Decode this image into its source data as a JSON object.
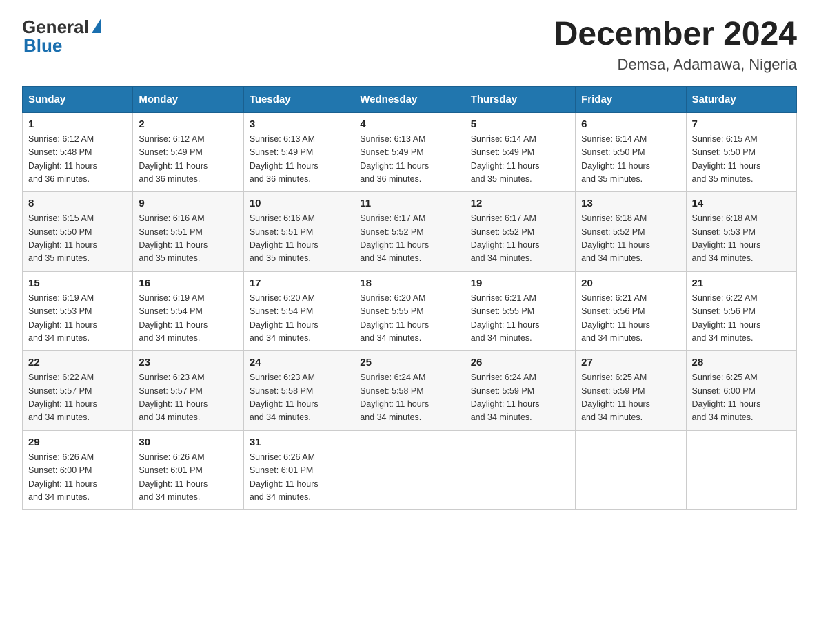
{
  "logo": {
    "general": "General",
    "blue": "Blue"
  },
  "title": "December 2024",
  "subtitle": "Demsa, Adamawa, Nigeria",
  "headers": [
    "Sunday",
    "Monday",
    "Tuesday",
    "Wednesday",
    "Thursday",
    "Friday",
    "Saturday"
  ],
  "weeks": [
    [
      {
        "day": "1",
        "sunrise": "6:12 AM",
        "sunset": "5:48 PM",
        "daylight": "11 hours and 36 minutes."
      },
      {
        "day": "2",
        "sunrise": "6:12 AM",
        "sunset": "5:49 PM",
        "daylight": "11 hours and 36 minutes."
      },
      {
        "day": "3",
        "sunrise": "6:13 AM",
        "sunset": "5:49 PM",
        "daylight": "11 hours and 36 minutes."
      },
      {
        "day": "4",
        "sunrise": "6:13 AM",
        "sunset": "5:49 PM",
        "daylight": "11 hours and 36 minutes."
      },
      {
        "day": "5",
        "sunrise": "6:14 AM",
        "sunset": "5:49 PM",
        "daylight": "11 hours and 35 minutes."
      },
      {
        "day": "6",
        "sunrise": "6:14 AM",
        "sunset": "5:50 PM",
        "daylight": "11 hours and 35 minutes."
      },
      {
        "day": "7",
        "sunrise": "6:15 AM",
        "sunset": "5:50 PM",
        "daylight": "11 hours and 35 minutes."
      }
    ],
    [
      {
        "day": "8",
        "sunrise": "6:15 AM",
        "sunset": "5:50 PM",
        "daylight": "11 hours and 35 minutes."
      },
      {
        "day": "9",
        "sunrise": "6:16 AM",
        "sunset": "5:51 PM",
        "daylight": "11 hours and 35 minutes."
      },
      {
        "day": "10",
        "sunrise": "6:16 AM",
        "sunset": "5:51 PM",
        "daylight": "11 hours and 35 minutes."
      },
      {
        "day": "11",
        "sunrise": "6:17 AM",
        "sunset": "5:52 PM",
        "daylight": "11 hours and 34 minutes."
      },
      {
        "day": "12",
        "sunrise": "6:17 AM",
        "sunset": "5:52 PM",
        "daylight": "11 hours and 34 minutes."
      },
      {
        "day": "13",
        "sunrise": "6:18 AM",
        "sunset": "5:52 PM",
        "daylight": "11 hours and 34 minutes."
      },
      {
        "day": "14",
        "sunrise": "6:18 AM",
        "sunset": "5:53 PM",
        "daylight": "11 hours and 34 minutes."
      }
    ],
    [
      {
        "day": "15",
        "sunrise": "6:19 AM",
        "sunset": "5:53 PM",
        "daylight": "11 hours and 34 minutes."
      },
      {
        "day": "16",
        "sunrise": "6:19 AM",
        "sunset": "5:54 PM",
        "daylight": "11 hours and 34 minutes."
      },
      {
        "day": "17",
        "sunrise": "6:20 AM",
        "sunset": "5:54 PM",
        "daylight": "11 hours and 34 minutes."
      },
      {
        "day": "18",
        "sunrise": "6:20 AM",
        "sunset": "5:55 PM",
        "daylight": "11 hours and 34 minutes."
      },
      {
        "day": "19",
        "sunrise": "6:21 AM",
        "sunset": "5:55 PM",
        "daylight": "11 hours and 34 minutes."
      },
      {
        "day": "20",
        "sunrise": "6:21 AM",
        "sunset": "5:56 PM",
        "daylight": "11 hours and 34 minutes."
      },
      {
        "day": "21",
        "sunrise": "6:22 AM",
        "sunset": "5:56 PM",
        "daylight": "11 hours and 34 minutes."
      }
    ],
    [
      {
        "day": "22",
        "sunrise": "6:22 AM",
        "sunset": "5:57 PM",
        "daylight": "11 hours and 34 minutes."
      },
      {
        "day": "23",
        "sunrise": "6:23 AM",
        "sunset": "5:57 PM",
        "daylight": "11 hours and 34 minutes."
      },
      {
        "day": "24",
        "sunrise": "6:23 AM",
        "sunset": "5:58 PM",
        "daylight": "11 hours and 34 minutes."
      },
      {
        "day": "25",
        "sunrise": "6:24 AM",
        "sunset": "5:58 PM",
        "daylight": "11 hours and 34 minutes."
      },
      {
        "day": "26",
        "sunrise": "6:24 AM",
        "sunset": "5:59 PM",
        "daylight": "11 hours and 34 minutes."
      },
      {
        "day": "27",
        "sunrise": "6:25 AM",
        "sunset": "5:59 PM",
        "daylight": "11 hours and 34 minutes."
      },
      {
        "day": "28",
        "sunrise": "6:25 AM",
        "sunset": "6:00 PM",
        "daylight": "11 hours and 34 minutes."
      }
    ],
    [
      {
        "day": "29",
        "sunrise": "6:26 AM",
        "sunset": "6:00 PM",
        "daylight": "11 hours and 34 minutes."
      },
      {
        "day": "30",
        "sunrise": "6:26 AM",
        "sunset": "6:01 PM",
        "daylight": "11 hours and 34 minutes."
      },
      {
        "day": "31",
        "sunrise": "6:26 AM",
        "sunset": "6:01 PM",
        "daylight": "11 hours and 34 minutes."
      },
      null,
      null,
      null,
      null
    ]
  ],
  "labels": {
    "sunrise": "Sunrise:",
    "sunset": "Sunset:",
    "daylight": "Daylight:"
  }
}
